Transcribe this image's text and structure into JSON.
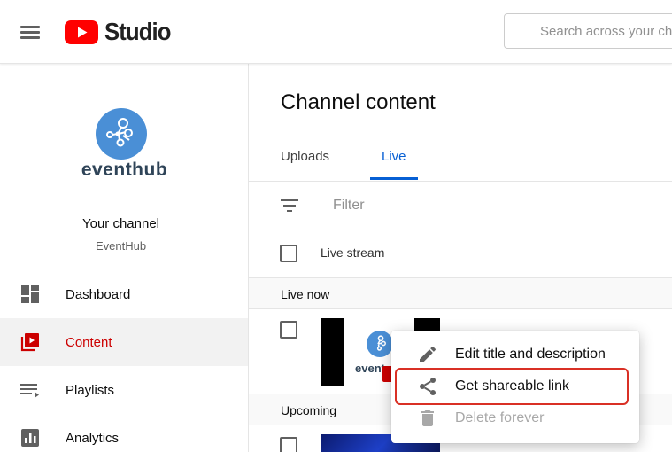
{
  "header": {
    "app_name": "Studio",
    "search_placeholder": "Search across your channel"
  },
  "sidebar": {
    "brand_text": "eventhub",
    "your_channel_label": "Your channel",
    "channel_name": "EventHub",
    "items": [
      {
        "label": "Dashboard",
        "icon": "dashboard-icon",
        "active": false
      },
      {
        "label": "Content",
        "icon": "content-icon",
        "active": true
      },
      {
        "label": "Playlists",
        "icon": "playlists-icon",
        "active": false
      },
      {
        "label": "Analytics",
        "icon": "analytics-icon",
        "active": false
      }
    ]
  },
  "main": {
    "title": "Channel content",
    "tabs": [
      {
        "label": "Uploads",
        "active": false
      },
      {
        "label": "Live",
        "active": true
      }
    ],
    "filter_placeholder": "Filter",
    "column_header": "Live stream",
    "sections": [
      {
        "label": "Live now"
      },
      {
        "label": "Upcoming"
      }
    ],
    "thumbnail_text": "event"
  },
  "context_menu": {
    "items": [
      {
        "label": "Edit title and description",
        "icon": "pencil-icon",
        "disabled": false
      },
      {
        "label": "Get shareable link",
        "icon": "share-icon",
        "disabled": false,
        "highlighted": true
      },
      {
        "label": "Delete forever",
        "icon": "trash-icon",
        "disabled": true
      }
    ]
  },
  "colors": {
    "accent_blue": "#065fd4",
    "active_red": "#cc0000",
    "brand_red": "#ff0000",
    "highlight_red": "#d93025"
  }
}
